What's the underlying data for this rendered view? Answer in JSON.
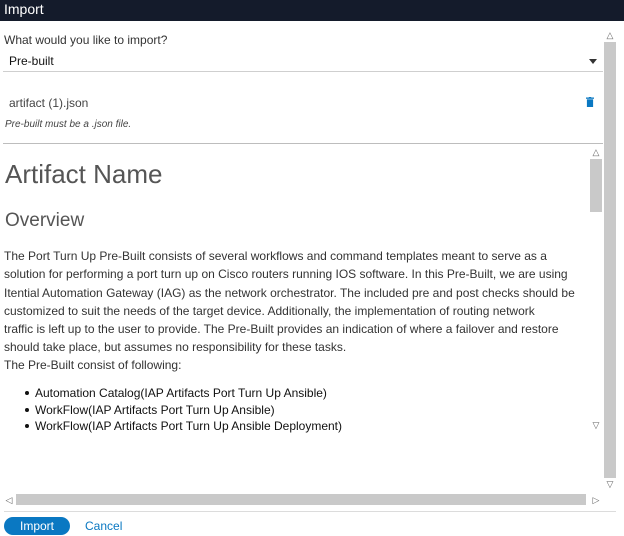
{
  "window": {
    "title": "Import"
  },
  "form": {
    "prompt": "What would you like to import?",
    "import_type": "Pre-built"
  },
  "file": {
    "name": "artifact (1).json",
    "hint": "Pre-built must be a .json file."
  },
  "preview": {
    "title": "Artifact Name",
    "section": "Overview",
    "description_lines": [
      "The Port Turn Up Pre-Built consists of several workflows and command templates meant to serve as a",
      "solution for performing a port turn up on Cisco routers running IOS software. In this Pre-Built, we are using",
      "Itential Automation Gateway (IAG) as the network orchestrator. The included pre and post checks should be",
      "customized to suit the needs of the target device. Additionally, the implementation of routing network",
      "traffic is left up to the user to provide. The Pre-Built provides an indication of where a failover and restore",
      "should take place, but assumes no responsibility for these tasks."
    ],
    "consist_label": "The Pre-Built consist of following:",
    "items": [
      "Automation Catalog(IAP Artifacts Port Turn Up Ansible)",
      "WorkFlow(IAP Artifacts Port Turn Up Ansible)",
      "WorkFlow(IAP Artifacts Port Turn Up Ansible Deployment)"
    ]
  },
  "footer": {
    "import_label": "Import",
    "cancel_label": "Cancel"
  },
  "colors": {
    "titlebar": "#141b2b",
    "accent": "#0a78c2",
    "scroll_thumb": "#c9c9c9"
  },
  "icons": {
    "delete": "trash-icon",
    "dropdown": "caret-down-icon"
  }
}
